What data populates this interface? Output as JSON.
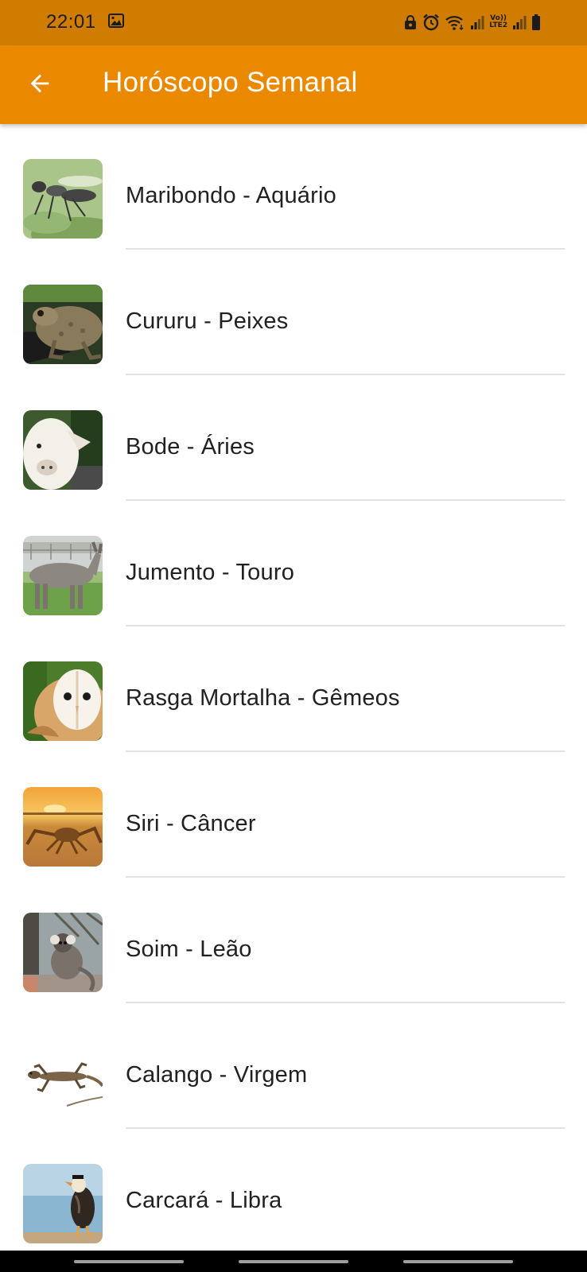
{
  "status_bar": {
    "time": "22:01",
    "network_label_top": "Vo))",
    "network_label_bottom": "LTE2",
    "icons": [
      "gallery-icon",
      "lock-icon",
      "alarm-icon",
      "wifi-icon",
      "signal-icon",
      "signal-icon",
      "battery-icon"
    ]
  },
  "app_bar": {
    "title": "Horóscopo Semanal",
    "back_icon": "arrow-back-icon",
    "color": "#ea8900",
    "status_color": "#d07c00"
  },
  "list": {
    "items": [
      {
        "label": "Maribondo - Aquário",
        "image": "wasp-image"
      },
      {
        "label": "Cururu - Peixes",
        "image": "toad-image"
      },
      {
        "label": "Bode - Áries",
        "image": "goat-image"
      },
      {
        "label": "Jumento - Touro",
        "image": "donkey-image"
      },
      {
        "label": "Rasga Mortalha - Gêmeos",
        "image": "owl-image"
      },
      {
        "label": "Siri - Câncer",
        "image": "crab-image"
      },
      {
        "label": "Soim - Leão",
        "image": "marmoset-image"
      },
      {
        "label": "Calango - Virgem",
        "image": "lizard-image"
      },
      {
        "label": "Carcará - Libra",
        "image": "caracara-image"
      }
    ]
  }
}
